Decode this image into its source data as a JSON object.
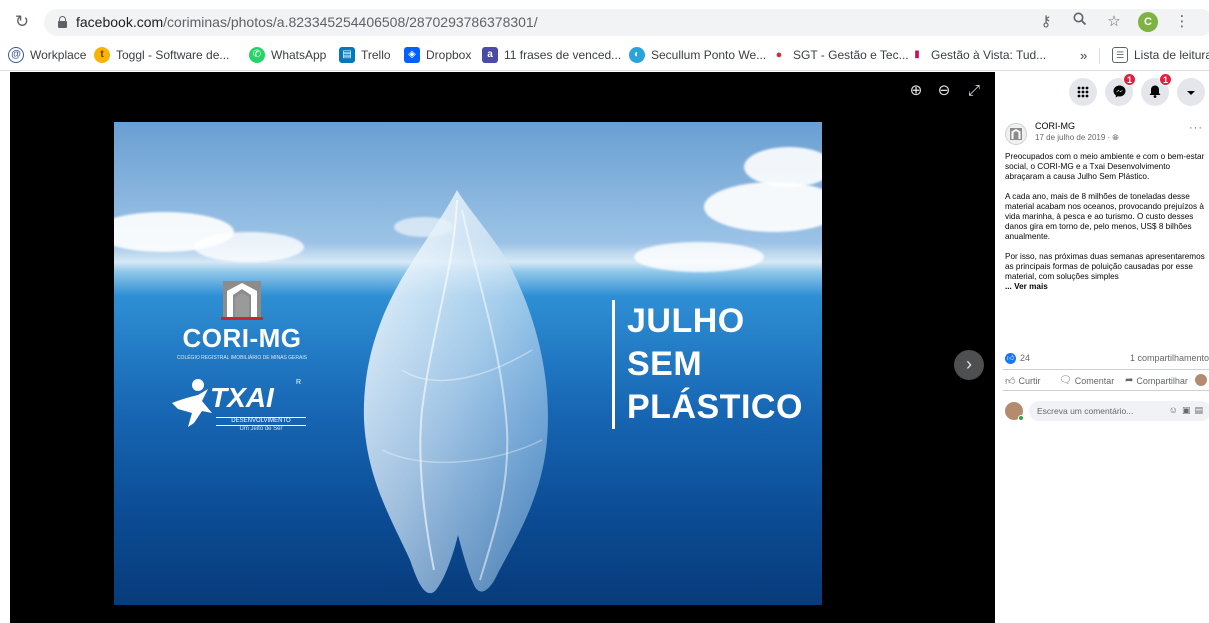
{
  "browser": {
    "url_host": "facebook.com",
    "url_path": "/coriminas/photos/a.823345254406508/2870293786378301/",
    "profile_initial": "C",
    "icons": [
      "reload-icon",
      "lock-icon",
      "key-icon",
      "zoom-icon",
      "star-icon",
      "menu-dots-icon"
    ]
  },
  "bookmarks": {
    "items": [
      {
        "label": "Workplace",
        "color": "#ffffff",
        "glyph": "@",
        "fg": "#3b5998"
      },
      {
        "label": "Toggl - Software de...",
        "color": "#f7b500",
        "glyph": "t",
        "fg": "#7a2a00"
      },
      {
        "label": "WhatsApp",
        "color": "#25d366",
        "glyph": "✆",
        "fg": "#ffffff"
      },
      {
        "label": "Trello",
        "color": "#0079bf",
        "glyph": "▤",
        "fg": "#ffffff"
      },
      {
        "label": "Dropbox",
        "color": "#0061ff",
        "glyph": "◈",
        "fg": "#ffffff"
      },
      {
        "label": "11 frases de venced...",
        "color": "#4a4aa8",
        "glyph": "a",
        "fg": "#ffffff"
      },
      {
        "label": "Secullum Ponto We...",
        "color": "#29a3dc",
        "glyph": "◐",
        "fg": "#ffffff"
      },
      {
        "label": "SGT - Gestão e Tec...",
        "color": "#ffffff",
        "glyph": "●",
        "fg": "#d32f2f"
      },
      {
        "label": "Gestão à Vista: Tud...",
        "color": "#ffffff",
        "glyph": "▮",
        "fg": "#c51162"
      }
    ],
    "overflow": "»",
    "reading_list": "Lista de leitura"
  },
  "viewer": {
    "zoom_in": "⊕",
    "zoom_out": "⊖",
    "expand": "⤢",
    "next": "›"
  },
  "photo": {
    "cori_name": "CORI-MG",
    "cori_sub": "COLÉGIO REGISTRAL IMOBILIÁRIO DE MINAS GERAIS",
    "txai_name": "TXAI",
    "txai_r": "R",
    "txai_sub": "DESENVOLVIMENTO",
    "txai_tag": "Um Jeito de Ser",
    "campaign_line1": "JULHO",
    "campaign_line2": "SEM",
    "campaign_line3": "PLÁSTICO"
  },
  "fb_nav": {
    "messenger_badge": "1",
    "notifications_badge": "1"
  },
  "post": {
    "page_name": "CORI-MG",
    "date": "17 de julho de 2019 · ",
    "more": "···",
    "paragraph1": "Preocupados com o meio ambiente e com o bem-estar social, o CORI-MG e a Txai Desenvolvimento abraçaram a causa Julho Sem Plástico.",
    "paragraph2": "A cada ano, mais de 8 milhões de toneladas desse material acabam nos oceanos, provocando prejuízos à vida marinha, à pesca e ao turismo. O custo desses danos gira em torno de, pelo menos, US$ 8 bilhões anualmente.",
    "paragraph3": "Por isso, nas próximas duas semanas apresentaremos as principais formas de poluição causadas por esse material, com soluções simples",
    "ver_mais": "... Ver mais",
    "likes": "24",
    "shares": "1 compartilhamento",
    "action_like": "Curtir",
    "action_comment": "Comentar",
    "action_share": "Compartilhar",
    "comment_placeholder": "Escreva um comentário..."
  }
}
